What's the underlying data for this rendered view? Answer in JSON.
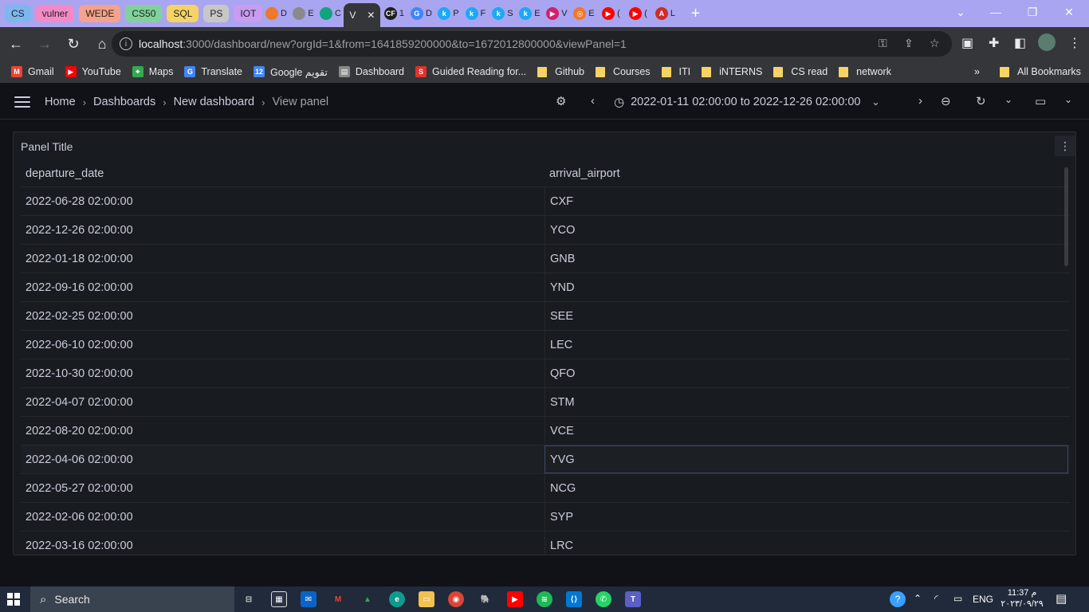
{
  "tabs": {
    "groups": [
      {
        "label": "CS",
        "color": "#7db7f0"
      },
      {
        "label": "vulner",
        "color": "#f38ac8"
      },
      {
        "label": "WEDE",
        "color": "#f6a28a"
      },
      {
        "label": "CS50",
        "color": "#7fd39a"
      },
      {
        "label": "SQL",
        "color": "#f6d365"
      },
      {
        "label": "PS",
        "color": "#c7c7c7"
      },
      {
        "label": "IOT",
        "color": "#c89cf0"
      }
    ],
    "mini": [
      {
        "letter": "D",
        "icon": "grafana-icon",
        "color": "#f0772b"
      },
      {
        "letter": "E",
        "icon": "globe-icon",
        "color": "#8a8a8a"
      },
      {
        "letter": "C",
        "icon": "chatgpt-icon",
        "color": "#10a37f"
      }
    ],
    "active": {
      "letter": "V",
      "close": "✕"
    },
    "mini_after": [
      {
        "letter": "1",
        "icon": "codeforces-icon",
        "color": "#1f1f1f",
        "glyph": "CF"
      },
      {
        "letter": "D",
        "icon": "google-icon",
        "color": "#4285f4",
        "glyph": "G"
      },
      {
        "letter": "P",
        "icon": "kibana-icon",
        "color": "#1ba9f5",
        "glyph": "k"
      },
      {
        "letter": "F",
        "icon": "kibana-icon",
        "color": "#1ba9f5",
        "glyph": "k"
      },
      {
        "letter": "S",
        "icon": "kibana-icon",
        "color": "#1ba9f5",
        "glyph": "k"
      },
      {
        "letter": "E",
        "icon": "kibana-icon",
        "color": "#1ba9f5",
        "glyph": "k"
      },
      {
        "letter": "V",
        "icon": "play-icon",
        "color": "#d61f69",
        "glyph": "▶"
      },
      {
        "letter": "E",
        "icon": "grafana-icon",
        "color": "#f0772b",
        "glyph": "◎"
      },
      {
        "letter": "(",
        "icon": "youtube-icon",
        "color": "#ff0000",
        "glyph": "▶"
      },
      {
        "letter": "(",
        "icon": "youtube-icon",
        "color": "#ff0000",
        "glyph": "▶"
      },
      {
        "letter": "L",
        "icon": "pdf-icon",
        "color": "#d02b2b",
        "glyph": "A"
      }
    ],
    "new_tab": "+"
  },
  "address_bar": {
    "host": "localhost",
    "rest": ":3000/dashboard/new?orgId=1&from=1641859200000&to=1672012800000&viewPanel=1"
  },
  "bookmarks": [
    {
      "label": "Gmail",
      "icon": "gmail-icon",
      "color": "#ea4335",
      "glyph": "M"
    },
    {
      "label": "YouTube",
      "icon": "youtube-icon",
      "color": "#ff0000",
      "glyph": "▶"
    },
    {
      "label": "Maps",
      "icon": "maps-icon",
      "color": "#34a853",
      "glyph": "⌖"
    },
    {
      "label": "Translate",
      "icon": "translate-icon",
      "color": "#4285f4",
      "glyph": "G"
    },
    {
      "label": "Google تقويم",
      "icon": "calendar-icon",
      "color": "#4285f4",
      "glyph": "12"
    },
    {
      "label": "Dashboard",
      "icon": "page-icon",
      "color": "#8a8a8a",
      "glyph": "▤"
    },
    {
      "label": "Guided Reading for...",
      "icon": "s-icon",
      "color": "#e0322b",
      "glyph": "S"
    }
  ],
  "bookmark_folders": [
    "Github",
    "Courses",
    "ITI",
    "iNTERNS",
    "CS read",
    "network"
  ],
  "bookmarks_more": "»",
  "all_bookmarks": "All Bookmarks",
  "breadcrumb": {
    "items": [
      "Home",
      "Dashboards",
      "New dashboard"
    ],
    "current": "View panel",
    "sep": "›"
  },
  "time_range": "2022-01-11 02:00:00 to 2022-12-26 02:00:00",
  "panel": {
    "title": "Panel Title",
    "columns": [
      "departure_date",
      "arrival_airport"
    ],
    "rows": [
      [
        "2022-06-28 02:00:00",
        "CXF"
      ],
      [
        "2022-12-26 02:00:00",
        "YCO"
      ],
      [
        "2022-01-18 02:00:00",
        "GNB"
      ],
      [
        "2022-09-16 02:00:00",
        "YND"
      ],
      [
        "2022-02-25 02:00:00",
        "SEE"
      ],
      [
        "2022-06-10 02:00:00",
        "LEC"
      ],
      [
        "2022-10-30 02:00:00",
        "QFO"
      ],
      [
        "2022-04-07 02:00:00",
        "STM"
      ],
      [
        "2022-08-20 02:00:00",
        "VCE"
      ],
      [
        "2022-04-06 02:00:00",
        "YVG"
      ],
      [
        "2022-05-27 02:00:00",
        "NCG"
      ],
      [
        "2022-02-06 02:00:00",
        "SYP"
      ],
      [
        "2022-03-16 02:00:00",
        "LRC"
      ]
    ],
    "highlighted_row": 9
  },
  "taskbar": {
    "search_placeholder": "Search",
    "lang": "ENG",
    "time": "11:37 م",
    "date": "٢٠٢٣/٠٩/٢٩"
  }
}
